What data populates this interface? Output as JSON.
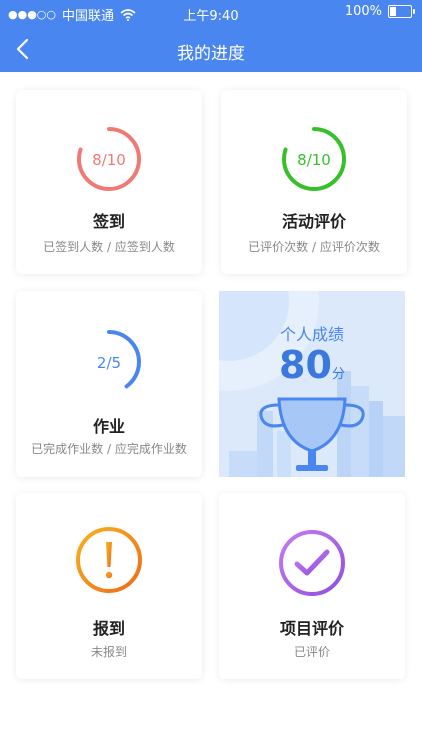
{
  "status_bar": {
    "carrier": "中国联通",
    "time": "上午9:40",
    "battery": "100%",
    "battery_level": 1.0
  },
  "nav": {
    "title": "我的进度"
  },
  "cards": {
    "signin": {
      "value": "8/10",
      "name": "签到",
      "desc": "已签到人数 / 应签到人数",
      "color": "#f07a73"
    },
    "activity": {
      "value": "8/10",
      "name": "活动评价",
      "desc": "已评价次数 / 应评价次数",
      "color": "#37c02a"
    },
    "homework": {
      "value": "2/5",
      "name": "作业",
      "desc": "已完成作业数 / 应完成作业数",
      "color": "#4a86f0"
    },
    "report": {
      "name": "报到",
      "desc": "未报到",
      "icon": "exclamation-icon",
      "color": "#f39a1a"
    },
    "project": {
      "name": "项目评价",
      "desc": "已评价",
      "icon": "check-icon",
      "color": "#a861e8"
    }
  },
  "score": {
    "label": "个人成绩",
    "value": "80",
    "unit": "分"
  }
}
